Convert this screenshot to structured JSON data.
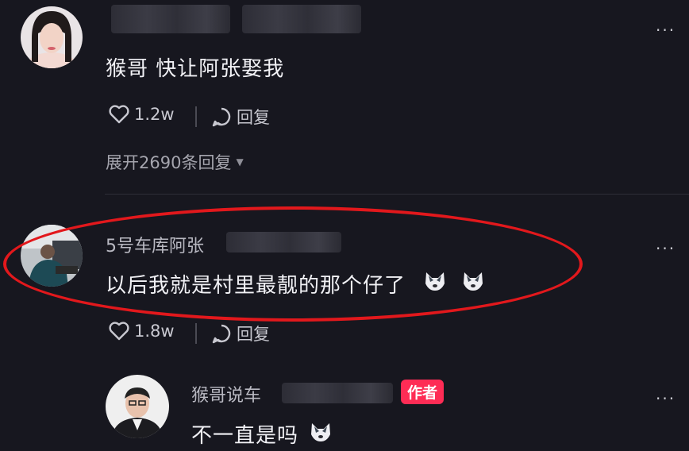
{
  "comments": [
    {
      "text": "猴哥 快让阿张娶我",
      "likes": "1.2w",
      "reply_label": "回复",
      "expand_replies": "展开2690条回复"
    },
    {
      "username": "5号车库阿张",
      "text": "以后我就是村里最靓的那个仔了",
      "likes": "1.8w",
      "reply_label": "回复"
    }
  ],
  "reply": {
    "username": "猴哥说车",
    "badge": "作者",
    "text": "不一直是吗"
  },
  "more_label": "···",
  "colors": {
    "background": "#17171f",
    "highlight_ring": "#e2181c",
    "author_badge": "#fe2c55"
  }
}
